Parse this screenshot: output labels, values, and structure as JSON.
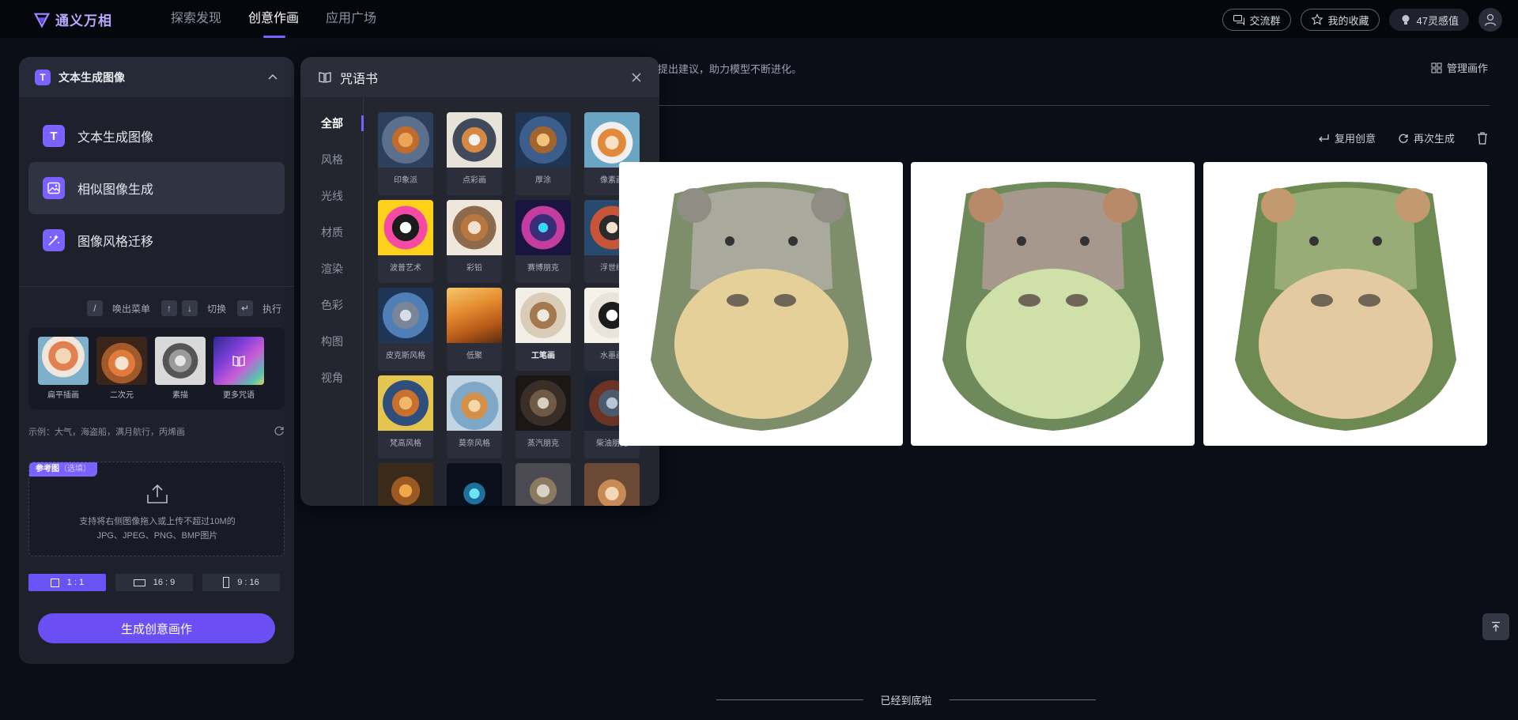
{
  "app": {
    "title": "通义万相"
  },
  "nav": [
    {
      "label": "探索发现",
      "active": false
    },
    {
      "label": "创意作画",
      "active": true
    },
    {
      "label": "应用广场",
      "active": false
    }
  ],
  "top_right": {
    "group_label": "交流群",
    "favorites_label": "我的收藏",
    "points_label": "47灵感值"
  },
  "left_panel": {
    "header_title": "文本生成图像",
    "modes": [
      {
        "label": "文本生成图像",
        "icon": "text-to-image-icon"
      },
      {
        "label": "相似图像生成",
        "icon": "similar-image-icon"
      },
      {
        "label": "图像风格迁移",
        "icon": "style-transfer-icon"
      }
    ],
    "shortcuts": {
      "menu_key": "/",
      "menu_label": "唤出菜单",
      "switch_label": "切换",
      "exec_label": "执行"
    },
    "styles": [
      {
        "label": "扁平插画"
      },
      {
        "label": "二次元"
      },
      {
        "label": "素描"
      },
      {
        "label": "更多咒语"
      }
    ],
    "example": "示例：大气，海盗船，满月航行，丙烯画",
    "reference": {
      "tag": "参考图",
      "tag_optional": "（选填）",
      "line1": "支持将右侧图像拖入或上传不超过10M的",
      "line2": "JPG、JPEG、PNG、BMP图片"
    },
    "ratios": [
      {
        "label": "1 : 1",
        "active": true
      },
      {
        "label": "16 : 9",
        "active": false
      },
      {
        "label": "9 : 16",
        "active": false
      }
    ],
    "generate_label": "生成创意画作"
  },
  "spellbook": {
    "title": "咒语书",
    "categories": [
      "全部",
      "风格",
      "光线",
      "材质",
      "渲染",
      "色彩",
      "构图",
      "视角"
    ],
    "items": [
      {
        "label": "印象派"
      },
      {
        "label": "点彩画"
      },
      {
        "label": "厚涂"
      },
      {
        "label": "像素画"
      },
      {
        "label": "波普艺术"
      },
      {
        "label": "彩铅"
      },
      {
        "label": "赛博朋克"
      },
      {
        "label": "浮世绘"
      },
      {
        "label": "皮克斯风格"
      },
      {
        "label": "低聚"
      },
      {
        "label": "工笔画"
      },
      {
        "label": "水墨画"
      },
      {
        "label": "梵高风格"
      },
      {
        "label": "莫奈风格"
      },
      {
        "label": "蒸汽朋克"
      },
      {
        "label": "柴油朋克"
      },
      {
        "label": ""
      },
      {
        "label": ""
      },
      {
        "label": ""
      },
      {
        "label": ""
      }
    ]
  },
  "main": {
    "tip": "提出建议，助力模型不断进化。",
    "manage_label": "管理画作",
    "actions": {
      "reuse_label": "复用创意",
      "regen_label": "再次生成"
    },
    "bottom_note": "已经到底啦"
  },
  "colors": {
    "accent": "#7b61ff",
    "background": "#0b0d17",
    "panel": "#1e212c"
  }
}
